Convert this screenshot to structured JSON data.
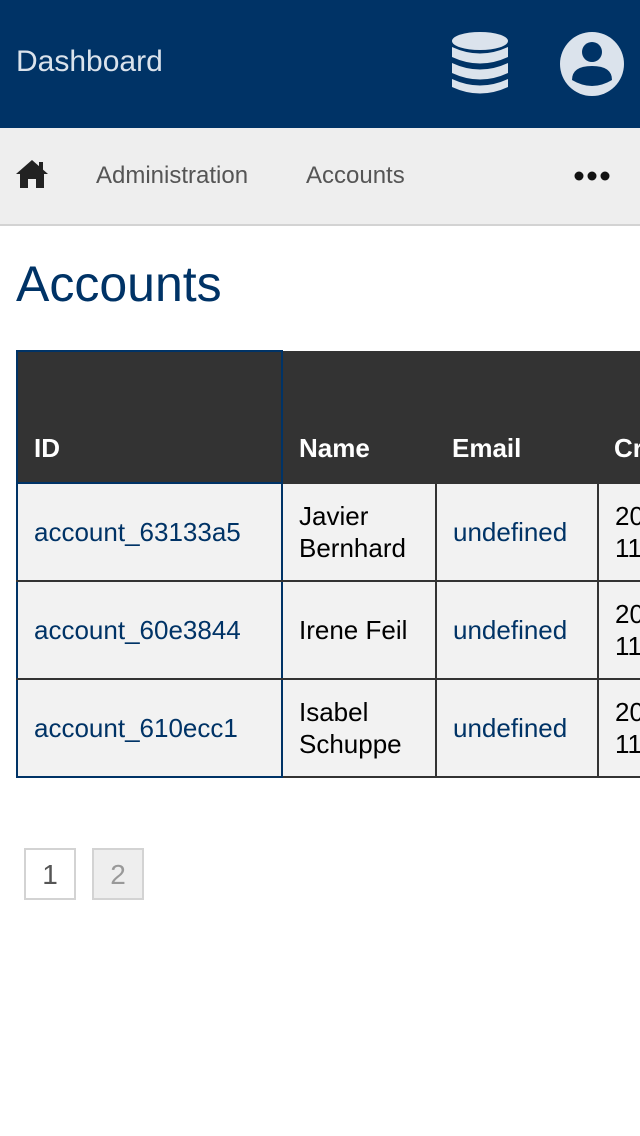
{
  "topbar": {
    "title": "Dashboard",
    "icons": [
      "database-icon",
      "user-account-icon"
    ],
    "background": "#003366"
  },
  "nav": {
    "home_icon": "home-icon",
    "items": [
      {
        "label": "Administration"
      },
      {
        "label": "Accounts"
      }
    ],
    "more_icon": "more-horizontal-icon",
    "background": "#eeeeee"
  },
  "page": {
    "title": "Accounts"
  },
  "table": {
    "columns": [
      "ID",
      "Name",
      "Email",
      "Created"
    ],
    "rows": [
      {
        "id": "account_63133a5",
        "name": "Javier Bernhard",
        "email": "undefined",
        "created": "20\n11"
      },
      {
        "id": "account_60e3844",
        "name": "Irene Feil",
        "email": "undefined",
        "created": "20\n11"
      },
      {
        "id": "account_610ecc1",
        "name": "Isabel Schuppe",
        "email": "undefined",
        "created": "20\n11"
      }
    ],
    "header_background": "#333333",
    "row_background": "#f2f2f2",
    "link_color": "#003366"
  },
  "pagination": {
    "pages": [
      "1",
      "2"
    ],
    "current": "1"
  }
}
